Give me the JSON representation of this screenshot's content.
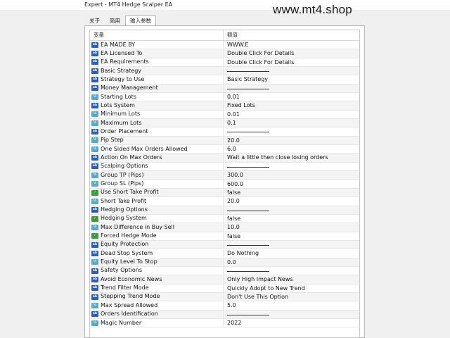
{
  "window": {
    "title": "Expert - MT4 Hedge Scalper EA",
    "watermark": "www.mt4.shop"
  },
  "tabs": [
    {
      "label": "关于",
      "active": false
    },
    {
      "label": "简用",
      "active": false
    },
    {
      "label": "输入参数",
      "active": true
    }
  ],
  "table": {
    "headers": {
      "name": "变量",
      "value": "额值"
    },
    "rows": [
      {
        "icon": "ab",
        "name": "EA MADE BY",
        "value": "WWW.E"
      },
      {
        "icon": "ab",
        "name": "EA Licensed To",
        "value": "Double Click For Details"
      },
      {
        "icon": "ab",
        "name": "EA Requirements",
        "value": "Double Click For Details"
      },
      {
        "icon": "ab",
        "name": "Basic Strategy",
        "value": ""
      },
      {
        "icon": "ab",
        "name": "Strategy to Use",
        "value": "Basic Strategy"
      },
      {
        "icon": "ab",
        "name": "Money Management",
        "value": ""
      },
      {
        "icon": "num",
        "name": "Starting Lots",
        "value": "0.01"
      },
      {
        "icon": "ab",
        "name": "Lots System",
        "value": "Fixed Lots"
      },
      {
        "icon": "num",
        "name": "Minimum Lots",
        "value": "0.01"
      },
      {
        "icon": "num",
        "name": "Maximum Lots",
        "value": "0.1"
      },
      {
        "icon": "ab",
        "name": "Order Placement",
        "value": ""
      },
      {
        "icon": "num",
        "name": "Pip Step",
        "value": "20.0"
      },
      {
        "icon": "num",
        "name": "One Sided Max Orders Allowed",
        "value": "6.0"
      },
      {
        "icon": "ab",
        "name": "Action On Max Orders",
        "value": "Wait a little then close losing orders"
      },
      {
        "icon": "ab",
        "name": "Scalping Options",
        "value": ""
      },
      {
        "icon": "num",
        "name": "Group TP (Pips)",
        "value": "300.0"
      },
      {
        "icon": "num",
        "name": "Group SL (Pips)",
        "value": "600.0"
      },
      {
        "icon": "bool",
        "name": "Use Short Take Profit",
        "value": "false"
      },
      {
        "icon": "num",
        "name": "Short Take Profit",
        "value": "20.0"
      },
      {
        "icon": "ab",
        "name": "Hedging Options",
        "value": ""
      },
      {
        "icon": "bool",
        "name": "Hedging System",
        "value": "false"
      },
      {
        "icon": "num",
        "name": "Max Difference in Buy Sell",
        "value": "10.0"
      },
      {
        "icon": "bool",
        "name": "Forced Hedge Mode",
        "value": "false"
      },
      {
        "icon": "ab",
        "name": "Equity Protection",
        "value": ""
      },
      {
        "icon": "ab",
        "name": "Dead Stop System",
        "value": "Do Nothing"
      },
      {
        "icon": "num",
        "name": "Equity Level To Stop",
        "value": "0.0"
      },
      {
        "icon": "ab",
        "name": "Safety Options",
        "value": ""
      },
      {
        "icon": "ab",
        "name": "Avoid Economic News",
        "value": "Only High Impact News"
      },
      {
        "icon": "ab",
        "name": "Trend Filter Mode",
        "value": "Quickly Adopt to New Trend"
      },
      {
        "icon": "ab",
        "name": "Stepping Trend Mode",
        "value": "Don't Use This Option"
      },
      {
        "icon": "num",
        "name": "Max Spread Allowed",
        "value": "5.0"
      },
      {
        "icon": "ab",
        "name": "Orders Identification",
        "value": ""
      },
      {
        "icon": "num",
        "name": "Magic Number",
        "value": "2022"
      }
    ]
  },
  "icon_types": {
    "ab": {
      "name": "string-param-icon",
      "glyph": "ab",
      "color": "#2d5fb0"
    },
    "num": {
      "name": "numeric-param-icon",
      "glyph": "½",
      "color": "#56a9c8"
    },
    "bool": {
      "name": "boolean-param-icon",
      "glyph": "✓",
      "color": "#3f9a3a"
    }
  }
}
